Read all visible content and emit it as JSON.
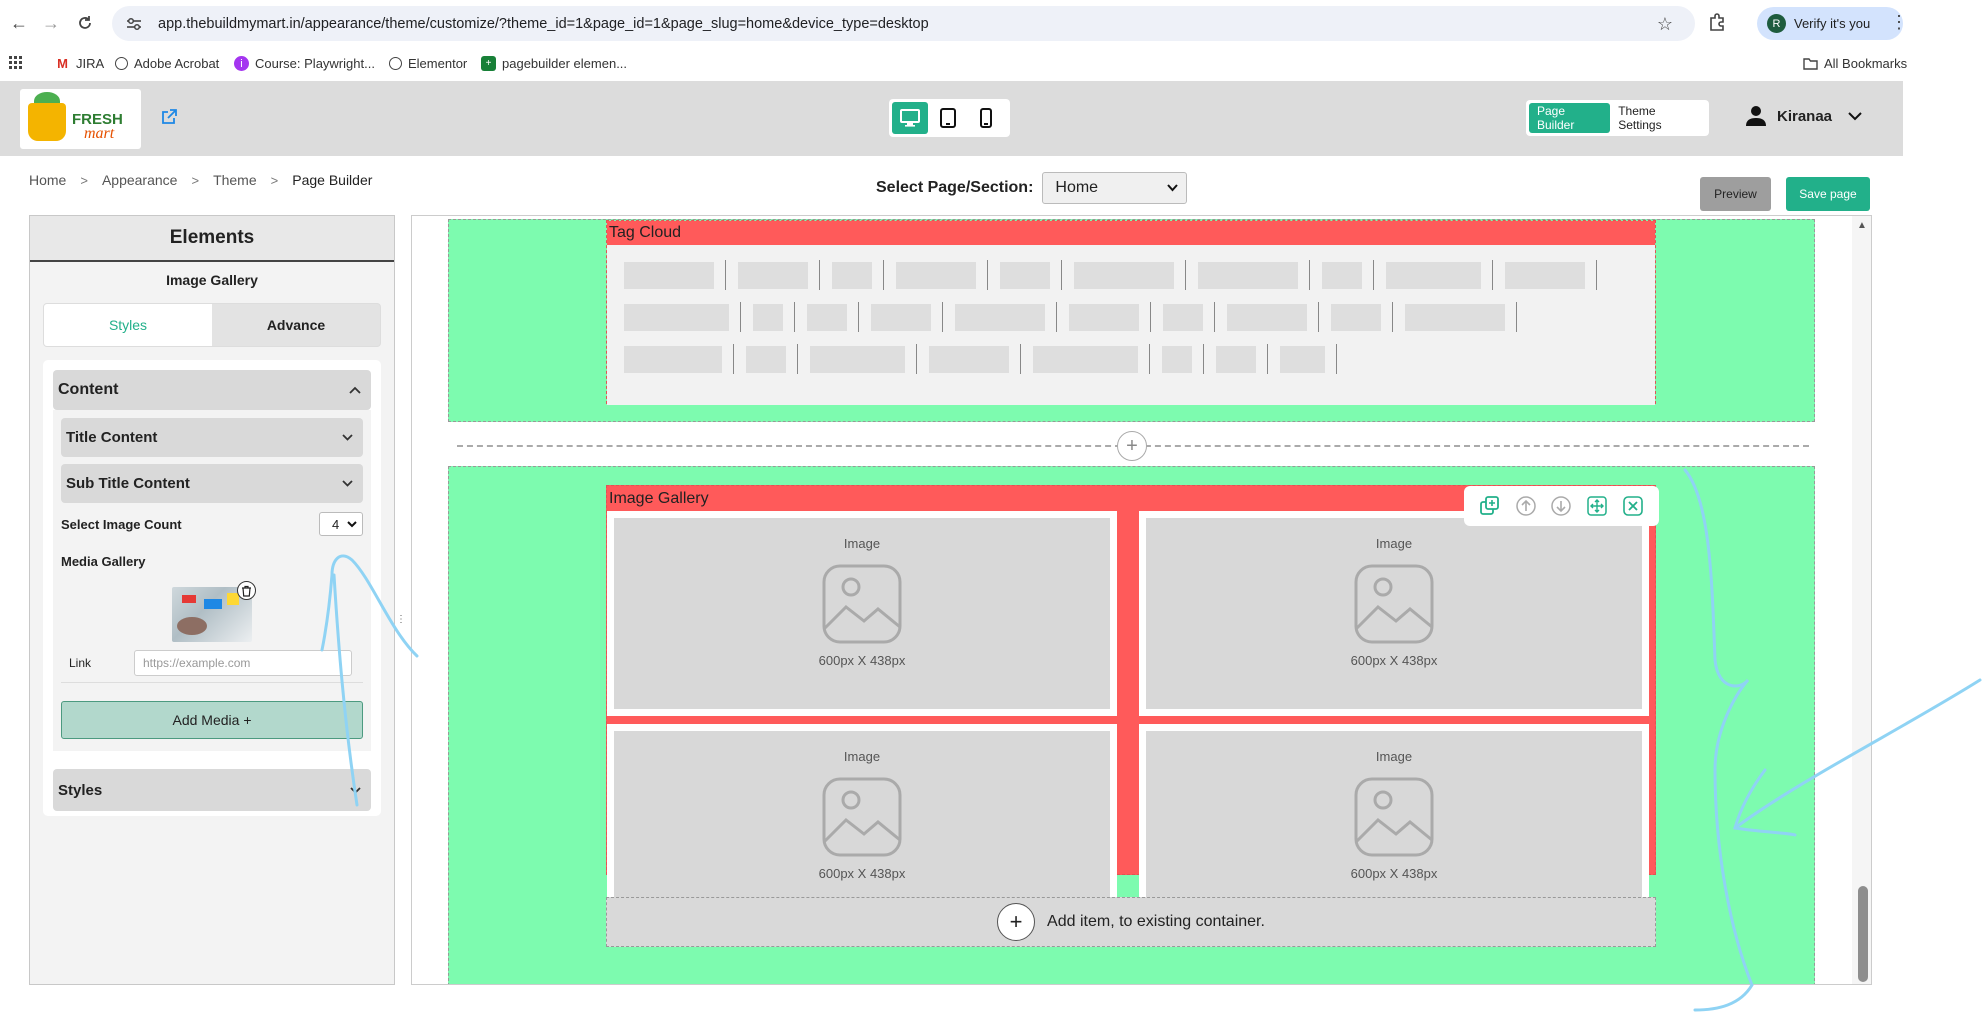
{
  "browser": {
    "url": "app.thebuildmymart.in/appearance/theme/customize/?theme_id=1&page_id=1&page_slug=home&device_type=desktop",
    "verify_label": "Verify it's you",
    "verify_avatar": "R",
    "bookmarks": [
      "JIRA",
      "Adobe Acrobat",
      "Course: Playwright...",
      "Elementor",
      "pagebuilder elemen..."
    ],
    "all_bookmarks": "All Bookmarks"
  },
  "header": {
    "logo_top": "FRESH",
    "logo_bottom": "mart",
    "mode_page_builder": "Page Builder",
    "mode_theme_settings": "Theme Settings",
    "user_name": "Kiranaa",
    "accent_color": "#22b08a"
  },
  "breadcrumb": {
    "items": [
      "Home",
      "Appearance",
      "Theme",
      "Page Builder"
    ]
  },
  "page_select": {
    "label": "Select Page/Section:",
    "value": "Home"
  },
  "actions": {
    "preview": "Preview",
    "save": "Save page"
  },
  "panel": {
    "title": "Elements",
    "subtitle": "Image Gallery",
    "tabs": [
      "Styles",
      "Advance"
    ],
    "content_label": "Content",
    "title_content": "Title Content",
    "sub_title_content": "Sub Title Content",
    "image_count_label": "Select Image Count",
    "image_count_value": "4",
    "media_gallery_label": "Media Gallery",
    "link_label": "Link",
    "link_placeholder": "https://example.com",
    "add_media": "Add Media +",
    "styles_label": "Styles"
  },
  "canvas": {
    "tag_cloud_title": "Tag Cloud",
    "image_gallery_title": "Image Gallery",
    "image_label": "Image",
    "image_size": "600px X 438px",
    "add_item": "Add item, to existing container.",
    "section_color": "#7dfbaf",
    "widget_header_color": "#ff5a5a"
  }
}
